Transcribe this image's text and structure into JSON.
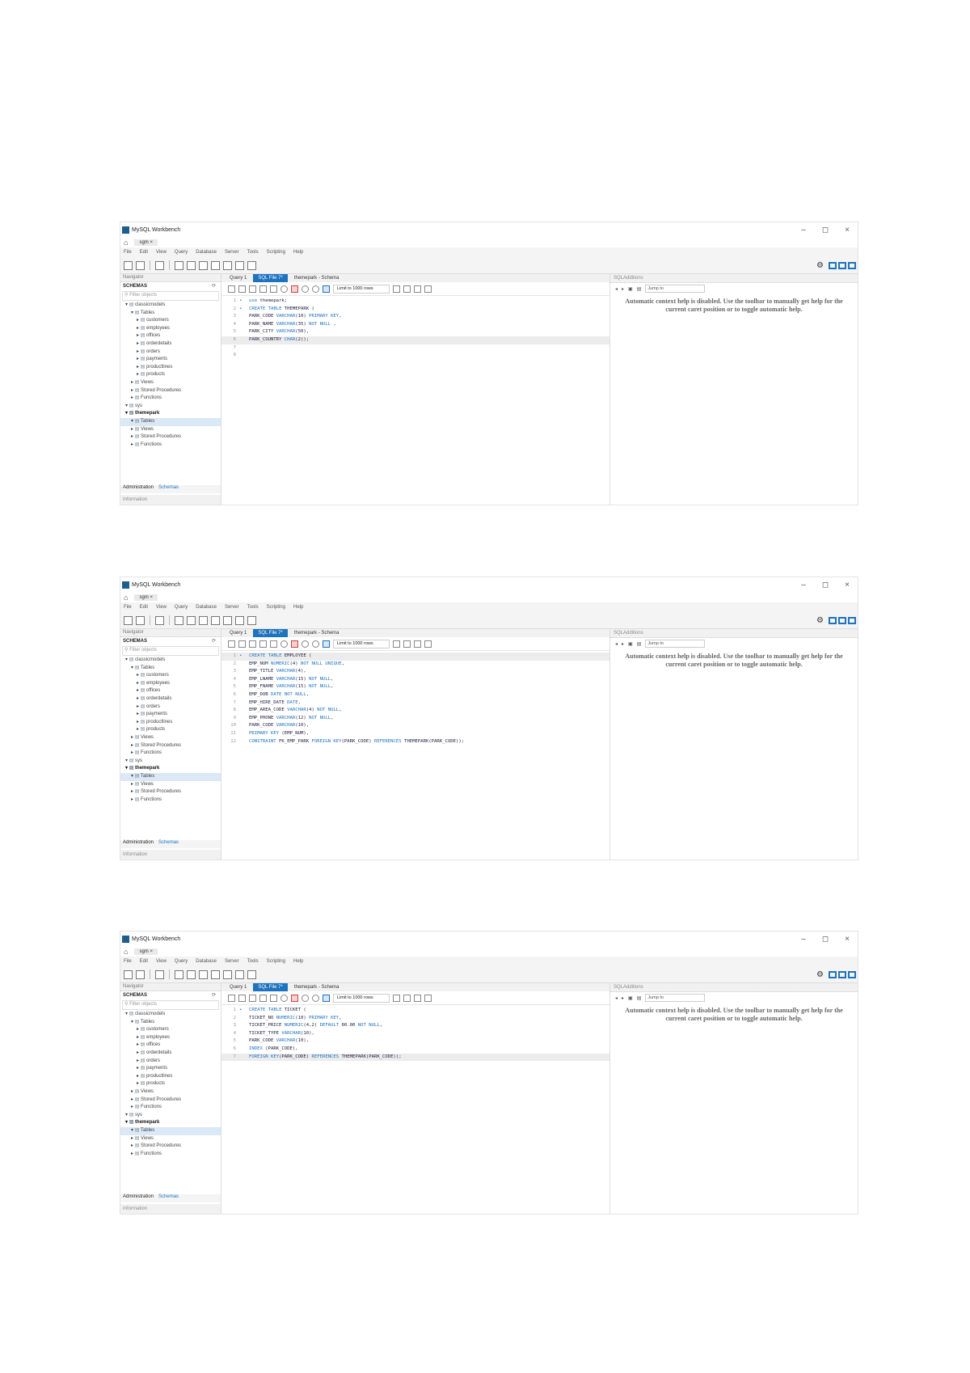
{
  "common": {
    "app_title": "MySQL Workbench",
    "conn_tab": "sgm",
    "menu": [
      "File",
      "Edit",
      "View",
      "Query",
      "Database",
      "Server",
      "Tools",
      "Scripting",
      "Help"
    ],
    "nav_header": "Navigator",
    "schemas_label": "SCHEMAS",
    "filter_placeholder": "Filter objects",
    "nav_tab_admin": "Administration",
    "nav_tab_schemas": "Schemas",
    "info_label": "Information",
    "editor_tabs": [
      "Query 1",
      "SQL File 7*",
      "themepark - Schema"
    ],
    "limit_label": "Limit to 1000 rows",
    "additions_label": "SQLAdditions",
    "jump_label": "Jump to",
    "help_text": "Automatic context help is disabled. Use the toolbar to manually get help for the current caret position or to toggle automatic help.",
    "window_controls": [
      "–",
      "◻",
      "×"
    ],
    "tree": [
      {
        "label": "classicmodels",
        "indent": 0,
        "style": "normal"
      },
      {
        "label": "Tables",
        "indent": 1,
        "style": "normal"
      },
      {
        "label": "customers",
        "indent": 2,
        "style": "normal"
      },
      {
        "label": "employees",
        "indent": 2,
        "style": "normal"
      },
      {
        "label": "offices",
        "indent": 2,
        "style": "normal"
      },
      {
        "label": "orderdetails",
        "indent": 2,
        "style": "normal"
      },
      {
        "label": "orders",
        "indent": 2,
        "style": "normal"
      },
      {
        "label": "payments",
        "indent": 2,
        "style": "normal"
      },
      {
        "label": "productlines",
        "indent": 2,
        "style": "normal"
      },
      {
        "label": "products",
        "indent": 2,
        "style": "normal"
      },
      {
        "label": "Views",
        "indent": 1,
        "style": "normal"
      },
      {
        "label": "Stored Procedures",
        "indent": 1,
        "style": "normal"
      },
      {
        "label": "Functions",
        "indent": 1,
        "style": "normal"
      },
      {
        "label": "sys",
        "indent": 0,
        "style": "normal"
      },
      {
        "label": "themepark",
        "indent": 0,
        "style": "bold"
      },
      {
        "label": "Tables",
        "indent": 1,
        "style": "sel"
      },
      {
        "label": "Views",
        "indent": 1,
        "style": "normal"
      },
      {
        "label": "Stored Procedures",
        "indent": 1,
        "style": "normal"
      },
      {
        "label": "Functions",
        "indent": 1,
        "style": "normal"
      }
    ]
  },
  "screenshots": [
    {
      "code": [
        "use themepark;",
        "CREATE TABLE THEMEPARK (",
        "PARK_CODE VARCHAR(10) PRIMARY KEY,",
        "PARK_NAME VARCHAR(35) NOT NULL ,",
        "PARK_CITY VARCHAR(50),",
        "PARK_COUNTRY CHAR(2));",
        "",
        ""
      ],
      "highlight_line": 6
    },
    {
      "code": [
        "CREATE TABLE EMPLOYEE (",
        "EMP_NUM NUMERIC(4) NOT NULL UNIQUE,",
        "EMP_TITLE VARCHAR(4),",
        "EMP_LNAME VARCHAR(15) NOT NULL,",
        "EMP_FNAME VARCHAR(15) NOT NULL,",
        "EMP_DOB DATE NOT NULL,",
        "EMP_HIRE_DATE DATE,",
        "EMP_AREA_CODE VARCHAR(4) NOT NULL,",
        "EMP_PHONE VARCHAR(12) NOT NULL,",
        "PARK_CODE VARCHAR(10),",
        "PRIMARY KEY (EMP_NUM),",
        "CONSTRAINT FK_EMP_PARK FOREIGN KEY(PARK_CODE) REFERENCES THEMEPARK(PARK_CODE));"
      ],
      "highlight_line": 1
    },
    {
      "code": [
        "CREATE TABLE TICKET (",
        "TICKET_NO NUMERIC(10) PRIMARY KEY,",
        "TICKET_PRICE NUMERIC(4,2) DEFAULT 00.00 NOT NULL,",
        "TICKET_TYPE VARCHAR(10),",
        "PARK_CODE VARCHAR(10),",
        "INDEX (PARK_CODE),",
        "FOREIGN KEY(PARK_CODE) REFERENCES THEMEPARK(PARK_CODE));"
      ],
      "highlight_line": 7
    }
  ]
}
